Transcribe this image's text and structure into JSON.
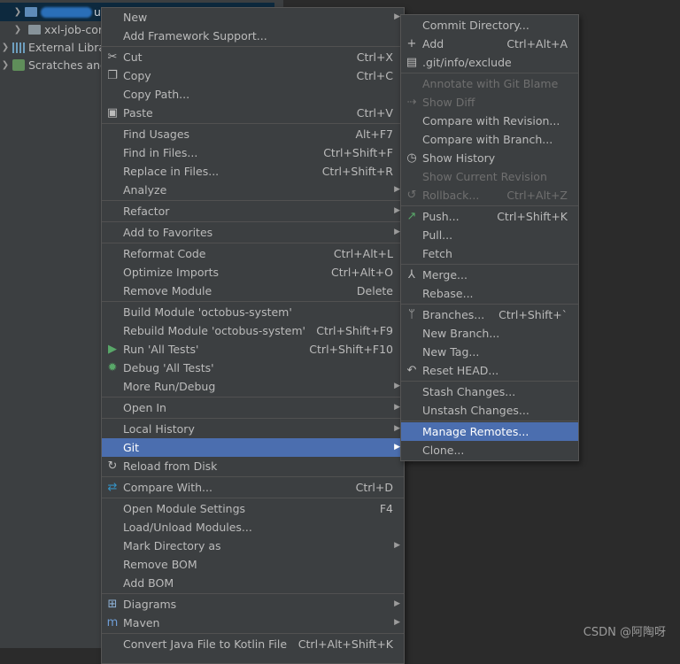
{
  "tree": {
    "items": [
      {
        "label": "us-s",
        "indent": 0
      },
      {
        "label": "xxl-job-cor",
        "indent": 1
      },
      {
        "label": "External Libra",
        "indent": 0
      },
      {
        "label": "Scratches and",
        "indent": 0
      }
    ]
  },
  "context_menu": {
    "items": [
      {
        "label": "New",
        "submenu": true
      },
      {
        "label": "Add Framework Support..."
      },
      {
        "sep": true
      },
      {
        "label": "Cut",
        "shortcut": "Ctrl+X",
        "icon": "✂",
        "icon_name": "cut-icon"
      },
      {
        "label": "Copy",
        "shortcut": "Ctrl+C",
        "icon": "❐",
        "icon_name": "copy-icon"
      },
      {
        "label": "Copy Path..."
      },
      {
        "label": "Paste",
        "shortcut": "Ctrl+V",
        "icon": "▣",
        "icon_name": "paste-icon"
      },
      {
        "sep": true
      },
      {
        "label": "Find Usages",
        "shortcut": "Alt+F7"
      },
      {
        "label": "Find in Files...",
        "shortcut": "Ctrl+Shift+F"
      },
      {
        "label": "Replace in Files...",
        "shortcut": "Ctrl+Shift+R"
      },
      {
        "label": "Analyze",
        "submenu": true
      },
      {
        "sep": true
      },
      {
        "label": "Refactor",
        "submenu": true
      },
      {
        "sep": true
      },
      {
        "label": "Add to Favorites",
        "submenu": true
      },
      {
        "sep": true
      },
      {
        "label": "Reformat Code",
        "shortcut": "Ctrl+Alt+L"
      },
      {
        "label": "Optimize Imports",
        "shortcut": "Ctrl+Alt+O"
      },
      {
        "label": "Remove Module",
        "shortcut": "Delete"
      },
      {
        "sep": true
      },
      {
        "label": "Build Module 'octobus-system'"
      },
      {
        "label": "Rebuild Module 'octobus-system'",
        "shortcut": "Ctrl+Shift+F9"
      },
      {
        "label": "Run 'All Tests'",
        "shortcut": "Ctrl+Shift+F10",
        "icon": "▶",
        "icon_name": "run-icon",
        "icon_color": "#59a869"
      },
      {
        "label": "Debug 'All Tests'",
        "icon": "✹",
        "icon_name": "debug-icon",
        "icon_color": "#59a869"
      },
      {
        "label": "More Run/Debug",
        "submenu": true
      },
      {
        "sep": true
      },
      {
        "label": "Open In",
        "submenu": true
      },
      {
        "sep": true
      },
      {
        "label": "Local History",
        "submenu": true
      },
      {
        "label": "Git",
        "submenu": true,
        "highlighted": true
      },
      {
        "label": "Reload from Disk",
        "icon": "↻",
        "icon_name": "reload-icon"
      },
      {
        "sep": true
      },
      {
        "label": "Compare With...",
        "shortcut": "Ctrl+D",
        "icon": "⇄",
        "icon_name": "compare-icon",
        "icon_color": "#3592c4"
      },
      {
        "sep": true
      },
      {
        "label": "Open Module Settings",
        "shortcut": "F4"
      },
      {
        "label": "Load/Unload Modules..."
      },
      {
        "label": "Mark Directory as",
        "submenu": true
      },
      {
        "label": "Remove BOM"
      },
      {
        "label": "Add BOM"
      },
      {
        "sep": true
      },
      {
        "label": "Diagrams",
        "submenu": true,
        "icon": "⊞",
        "icon_name": "diagrams-icon",
        "icon_color": "#8fb3d9"
      },
      {
        "label": "Maven",
        "submenu": true,
        "icon": "m",
        "icon_name": "maven-icon",
        "icon_color": "#6f9fd8"
      },
      {
        "sep": true
      },
      {
        "label": "Convert Java File to Kotlin File",
        "shortcut": "Ctrl+Alt+Shift+K"
      }
    ]
  },
  "git_submenu": {
    "items": [
      {
        "label": "Commit Directory..."
      },
      {
        "label": "Add",
        "shortcut": "Ctrl+Alt+A",
        "icon": "+",
        "icon_name": "add-icon"
      },
      {
        "label": ".git/info/exclude",
        "icon": "▤",
        "icon_name": "exclude-file-icon"
      },
      {
        "sep": true
      },
      {
        "label": "Annotate with Git Blame",
        "disabled": true
      },
      {
        "label": "Show Diff",
        "disabled": true,
        "icon": "⇢",
        "icon_name": "diff-icon"
      },
      {
        "label": "Compare with Revision..."
      },
      {
        "label": "Compare with Branch..."
      },
      {
        "label": "Show History",
        "icon": "◷",
        "icon_name": "history-icon"
      },
      {
        "label": "Show Current Revision",
        "disabled": true
      },
      {
        "label": "Rollback...",
        "shortcut": "Ctrl+Alt+Z",
        "disabled": true,
        "icon": "↺",
        "icon_name": "rollback-icon"
      },
      {
        "sep": true
      },
      {
        "label": "Push...",
        "shortcut": "Ctrl+Shift+K",
        "icon": "↗",
        "icon_name": "push-icon",
        "icon_color": "#59a869"
      },
      {
        "label": "Pull..."
      },
      {
        "label": "Fetch"
      },
      {
        "sep": true
      },
      {
        "label": "Merge...",
        "icon": "⅄",
        "icon_name": "merge-icon"
      },
      {
        "label": "Rebase..."
      },
      {
        "sep": true
      },
      {
        "label": "Branches...",
        "shortcut": "Ctrl+Shift+`",
        "icon": "ᛘ",
        "icon_name": "branches-icon"
      },
      {
        "label": "New Branch..."
      },
      {
        "label": "New Tag..."
      },
      {
        "label": "Reset HEAD...",
        "icon": "↶",
        "icon_name": "reset-icon"
      },
      {
        "sep": true
      },
      {
        "label": "Stash Changes..."
      },
      {
        "label": "Unstash Changes..."
      },
      {
        "sep": true
      },
      {
        "label": "Manage Remotes...",
        "highlighted": true
      },
      {
        "label": "Clone..."
      }
    ]
  },
  "watermark": "CSDN @阿陶呀"
}
